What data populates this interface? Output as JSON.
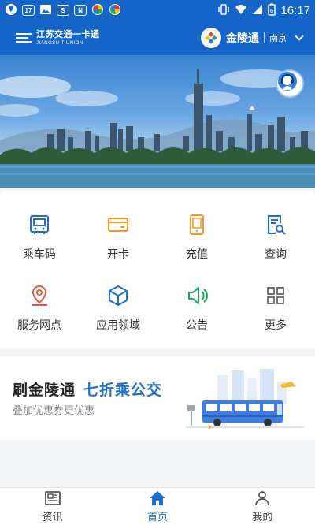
{
  "status_bar": {
    "notif_badge": "17",
    "time": "16:17",
    "battery": "6",
    "left_icons": [
      "map-pin-icon",
      "calendar-icon",
      "image-icon",
      "s-app-icon",
      "n-app-icon",
      "color-app-icon",
      "color-app-icon"
    ],
    "right_icons": [
      "vibrate-icon",
      "wifi-icon",
      "signal-icon",
      "battery-icon"
    ]
  },
  "header": {
    "logo_cn": "江苏交通一卡通",
    "logo_en": "JIANGSU T-UNION",
    "brand_name": "金陵通",
    "city": "南京",
    "bg_color": "#1565c8"
  },
  "banner": {
    "customer_service_icon": "customer-service-icon"
  },
  "menu": {
    "items": [
      {
        "label": "乘车码",
        "icon": "bus-code-icon",
        "color": "#1f6fcf"
      },
      {
        "label": "开卡",
        "icon": "card-icon",
        "color": "#f29a21"
      },
      {
        "label": "充值",
        "icon": "phone-topup-icon",
        "color": "#f29a21"
      },
      {
        "label": "查询",
        "icon": "search-doc-icon",
        "color": "#1f6fcf"
      },
      {
        "label": "服务网点",
        "icon": "location-icon",
        "color": "#e9553d"
      },
      {
        "label": "应用领域",
        "icon": "cube-icon",
        "color": "#1f6fcf"
      },
      {
        "label": "公告",
        "icon": "speaker-icon",
        "color": "#1ea35c"
      },
      {
        "label": "更多",
        "icon": "grid-icon",
        "color": "#666666"
      }
    ]
  },
  "promo": {
    "title": "刷金陵通",
    "highlight": "七折乘公交",
    "subtitle": "叠加优惠券更优惠",
    "highlight_color": "#1f6fcf"
  },
  "tabbar": {
    "tabs": [
      {
        "label": "资讯",
        "icon": "news-icon",
        "active": false
      },
      {
        "label": "首页",
        "icon": "home-icon",
        "active": true
      },
      {
        "label": "我的",
        "icon": "user-icon",
        "active": false
      }
    ]
  }
}
